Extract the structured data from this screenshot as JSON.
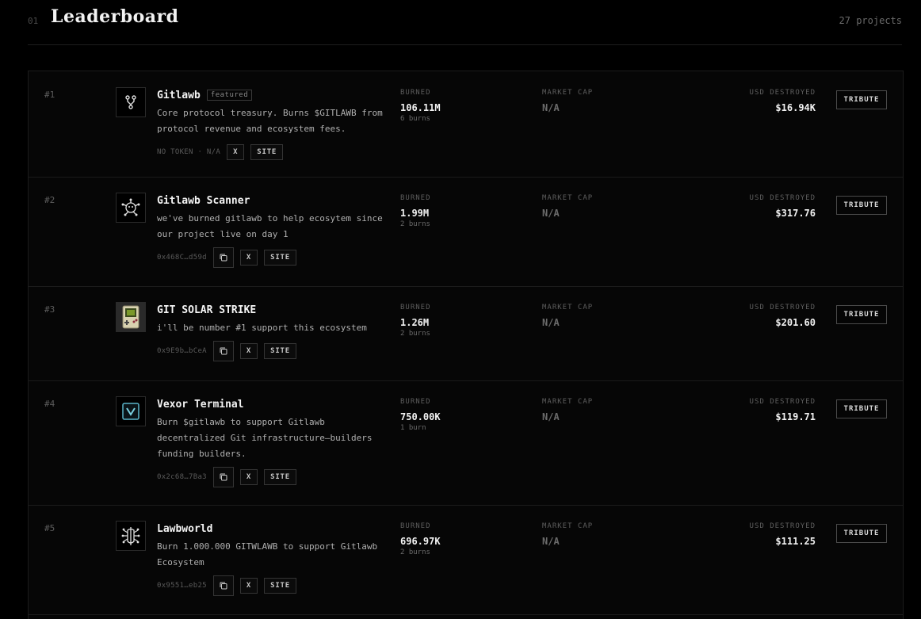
{
  "header": {
    "section_number": "01",
    "title": "Leaderboard",
    "project_count": "27 projects"
  },
  "labels": {
    "burned": "BURNED",
    "market_cap": "MARKET CAP",
    "usd_destroyed": "USD DESTROYED",
    "tribute": "TRIBUTE",
    "x": "X",
    "site": "SITE",
    "featured": "featured"
  },
  "rows": [
    {
      "rank": "#1",
      "name": "Gitlawb",
      "featured": true,
      "desc": "Core protocol treasury. Burns $GITLAWB from protocol revenue and ecosystem fees.",
      "address": "NO TOKEN · N/A",
      "burned": "106.11M",
      "burns": "6 burns",
      "market_cap": "N/A",
      "usd": "$16.94K",
      "logo_icon": "git-fork-icon"
    },
    {
      "rank": "#2",
      "name": "Gitlawb Scanner",
      "featured": false,
      "desc": "we've burned gitlawb to help ecosytem since our project live on day 1",
      "address": "0x468C…d59d",
      "burned": "1.99M",
      "burns": "2 burns",
      "market_cap": "N/A",
      "usd": "$317.76",
      "logo_icon": "network-node-icon"
    },
    {
      "rank": "#3",
      "name": "GIT SOLAR STRIKE",
      "featured": false,
      "desc": "i'll be number #1 support this ecosystem",
      "address": "0x9E9b…bCeA",
      "burned": "1.26M",
      "burns": "2 burns",
      "market_cap": "N/A",
      "usd": "$201.60",
      "logo_icon": "gameboy-icon"
    },
    {
      "rank": "#4",
      "name": "Vexor Terminal",
      "featured": false,
      "desc": "Burn $gitlawb to support Gitlawb decentralized Git infrastructure—builders funding builders.",
      "address": "0x2c68…7Ba3",
      "burned": "750.00K",
      "burns": "1 burn",
      "market_cap": "N/A",
      "usd": "$119.71",
      "logo_icon": "v-terminal-icon"
    },
    {
      "rank": "#5",
      "name": "Lawbworld",
      "featured": false,
      "desc": "Burn 1.000.000 GITWLAWB to support Gitlawb Ecosystem",
      "address": "0x9551…eb25",
      "burned": "696.97K",
      "burns": "2 burns",
      "market_cap": "N/A",
      "usd": "$111.25",
      "logo_icon": "lobster-circuit-icon"
    }
  ]
}
